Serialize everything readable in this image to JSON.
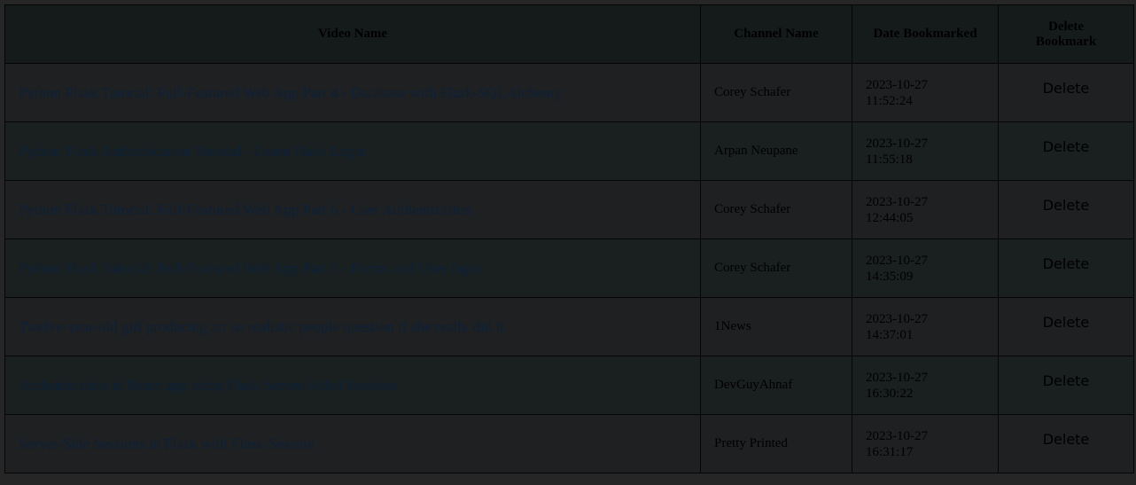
{
  "table": {
    "headers": {
      "video_name": "Video Name",
      "channel_name": "Channel Name",
      "date_bookmarked": "Date Bookmarked",
      "delete_line1": "Delete",
      "delete_line2": "Bookmark"
    },
    "rows": [
      {
        "video": "Python Flask Tutorial: Full-Featured Web App Part 4 - Database with Flask-SQLAlchemy",
        "channel": "Corey Schafer",
        "date": "2023-10-27",
        "time": "11:52:24",
        "action": "Delete"
      },
      {
        "video": "Python Flask Authentication Tutorial - Learn Flask Login",
        "channel": "Arpan Neupane",
        "date": "2023-10-27",
        "time": "11:55:18",
        "action": "Delete"
      },
      {
        "video": "Python Flask Tutorial: Full-Featured Web App Part 6 - User Authentication",
        "channel": "Corey Schafer",
        "date": "2023-10-27",
        "time": "12:44:05",
        "action": "Delete"
      },
      {
        "video": "Python Flask Tutorial: Full-Featured Web App Part 3 - Forms and User Input",
        "channel": "Corey Schafer",
        "date": "2023-10-27",
        "time": "14:35:09",
        "action": "Delete"
      },
      {
        "video": "Twelve-year-old girl producing art so realistic people question if she really did it",
        "channel": "1News",
        "date": "2023-10-27",
        "time": "14:37:01",
        "action": "Delete"
      },
      {
        "video": "Authentication in React app using Flask Server-Sided Sessions",
        "channel": "DevGuyAhnaf",
        "date": "2023-10-27",
        "time": "16:30:22",
        "action": "Delete"
      },
      {
        "video": "Server-Side Sessions in Flask with Flask-Session",
        "channel": "Pretty Printed",
        "date": "2023-10-27",
        "time": "16:31:17",
        "action": "Delete"
      }
    ]
  },
  "colors": {
    "page_bg": "#262626",
    "header_bg": "#151b1b",
    "link": "#0c2138",
    "border": "#050505"
  }
}
